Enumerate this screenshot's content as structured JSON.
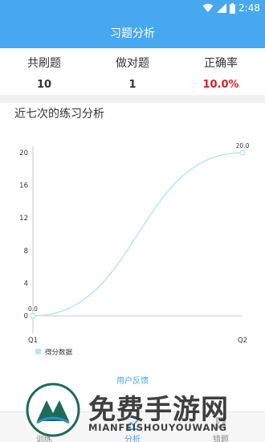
{
  "status_bar": {
    "time": "2:48"
  },
  "app_bar": {
    "title": "习题分析"
  },
  "stats": [
    {
      "label": "共刷题",
      "value": "10"
    },
    {
      "label": "做对题",
      "value": "1"
    },
    {
      "label": "正确率",
      "value": "10.0%",
      "value_color": "#d81f26"
    }
  ],
  "section": {
    "title": "近七次的练习分析"
  },
  "chart_data": {
    "type": "line",
    "categories": [
      "Q1",
      "Q2"
    ],
    "series": [
      {
        "name": "得分数据",
        "values": [
          0.0,
          20.0
        ],
        "color": "#b5e6f4"
      }
    ],
    "point_labels": [
      "0.0",
      "20.0"
    ],
    "ylim": [
      0,
      20
    ],
    "yticks": [
      "0",
      "4",
      "8",
      "12",
      "16",
      "20"
    ],
    "legend": "bottom-left",
    "grid": false
  },
  "feedback_link": "用户反馈",
  "tabs": [
    {
      "label": "训练",
      "active": false
    },
    {
      "label": "分析",
      "active": true
    },
    {
      "label": "错题",
      "active": false
    }
  ],
  "watermark": {
    "title": "免费手游网",
    "subtitle": "MIANFEISHOUYOUWANG"
  },
  "colors": {
    "primary": "#47a8f0",
    "accent_red": "#d81f26",
    "line": "#b5e6f4"
  }
}
